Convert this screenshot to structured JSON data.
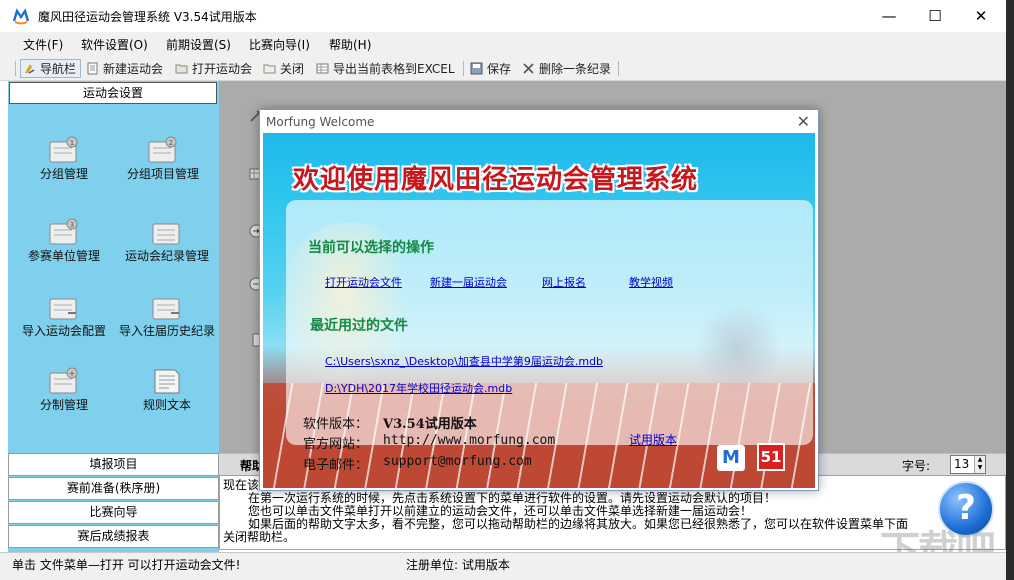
{
  "window": {
    "title": "魔风田径运动会管理系统 V3.54试用版本",
    "minimize": "—",
    "maximize": "☐",
    "close": "✕"
  },
  "menu": [
    "文件(F)",
    "软件设置(O)",
    "前期设置(S)",
    "比赛向导(I)",
    "帮助(H)"
  ],
  "toolbar": {
    "nav": "导航栏",
    "new_meet": "新建运动会",
    "open_meet": "打开运动会",
    "close": "关闭",
    "export_excel": "导出当前表格到EXCEL",
    "save": "保存",
    "delete_record": "删除一条纪录"
  },
  "nav": {
    "header": "运动会设置",
    "tiles": [
      "分组管理",
      "分组项目管理",
      "参赛单位管理",
      "运动会纪录管理",
      "导入运动会配置",
      "导入往届历史纪录",
      "分制管理",
      "规则文本"
    ],
    "bottom_buttons": [
      "填报项目",
      "赛前准备(秩序册)",
      "比赛向导",
      "赛后成绩报表"
    ]
  },
  "helpbar": {
    "title": "帮助",
    "font_size_label": "字号:",
    "font_size_value": "13"
  },
  "help_text": {
    "line1": "现在该",
    "line2": "在第一次运行系统的时候，先点击系统设置下的菜单进行软件的设置。请先设置运动会默认的项目！",
    "line3": "您也可以单击文件菜单打开以前建立的运动会文件，还可以单击文件菜单选择新建一届运动会！",
    "line4": "如果后面的帮助文字太多，看不完整，您可以拖动帮助栏的边缘将其放大。如果您已经很熟悉了，您可以在软件设置菜单下面",
    "line5": "关闭帮助栏。"
  },
  "statusbar": {
    "hint": "单击 文件菜单—打开 可以打开运动会文件!",
    "registered": "注册单位: 试用版本"
  },
  "dialog": {
    "title": "Morfung Welcome",
    "heading": "欢迎使用魔风田径运动会管理系统",
    "section_actions": "当前可以选择的操作",
    "actions": [
      "打开运动会文件",
      "新建一届运动会",
      "网上报名",
      "教学视频"
    ],
    "section_recent": "最近用过的文件",
    "recent_files": [
      "C:\\Users\\sxnz_\\Desktop\\加查县中学第9届运动会.mdb",
      "D:\\YDH\\2017年学校田径运动会.mdb"
    ],
    "version_label": "软件版本：",
    "version_value": "V3.54试用版本",
    "trial_link": "试用版本",
    "website_label": "官方网站：",
    "website_value": "http://www.morfung.com",
    "email_label": "电子邮件：",
    "email_value": "support@morfung.com",
    "logo_m": "M",
    "logo_51": "51"
  },
  "watermark": "下载吧",
  "colors": {
    "nav_panel": "#7fd0ec",
    "main_area": "#ababab",
    "heading_red": "#c8161d",
    "section_green": "#138a44",
    "link_blue": "#0000cc"
  }
}
